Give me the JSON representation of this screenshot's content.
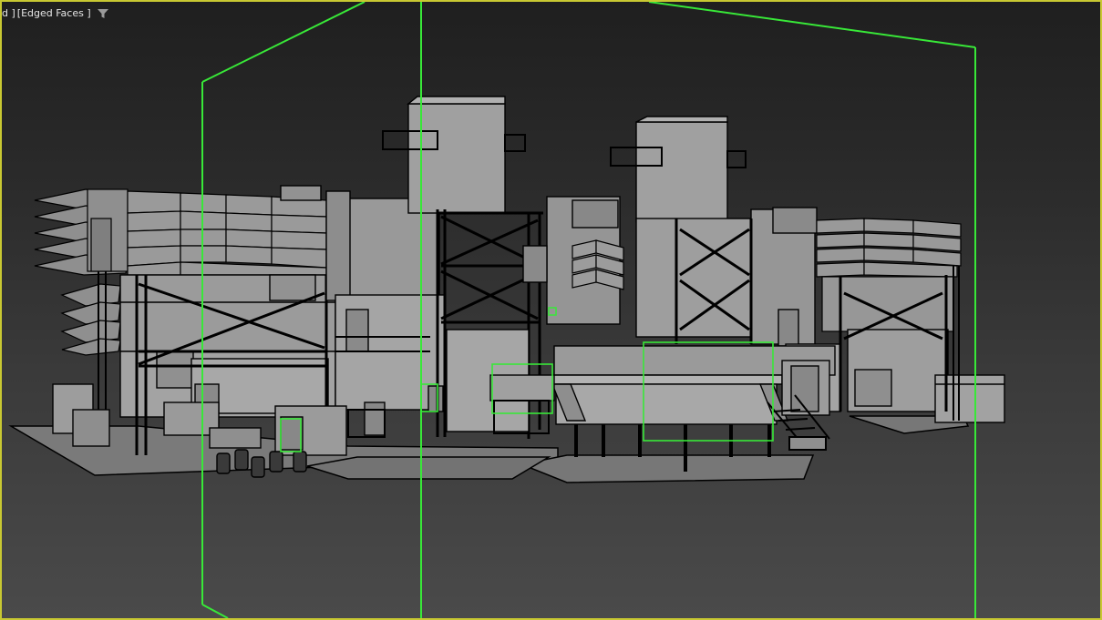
{
  "viewport": {
    "label_left": "d ]",
    "shading_mode": "[Edged Faces ]",
    "filter_icon": "funnel-icon",
    "border_color": "#c8c832",
    "selection_color": "#38e838",
    "wire_color": "#000000",
    "fill_color": "#8f8f8f"
  }
}
